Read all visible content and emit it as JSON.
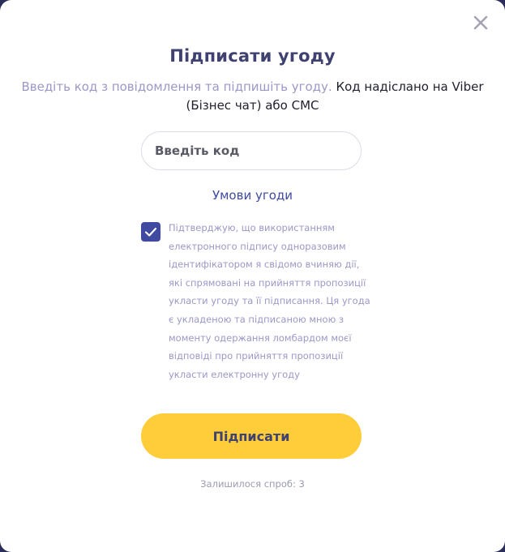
{
  "dialog": {
    "title": "Підписати угоду",
    "subtitle_muted": "Введіть код з повідомлення та підпишіть угоду.",
    "subtitle_dark": " Код надіслано на Viber (Бізнес чат) або СМС",
    "code_input": {
      "placeholder": "Введіть код",
      "value": ""
    },
    "terms_link": "Умови угоди",
    "consent": {
      "checked": true,
      "text": "Підтверджую, що використанням електронного підпису одноразовим ідентифікатором я свідомо вчиняю дії, які спрямовані на прийняття пропозиції укласти угоду та її підписання. Ця угода є укладеною та підписаною мною з моменту одержання ломбардом моєї відповіді про прийняття пропозиції укласти електронну угоду"
    },
    "sign_button": "Підписати",
    "attempts_text": "Залишилося спроб: 3"
  },
  "icons": {
    "close": "close-icon",
    "check": "checkmark-icon"
  },
  "colors": {
    "primary": "#3f4aa0",
    "accent": "#ffcc3a",
    "title": "#3f4170",
    "muted": "#9b98c7"
  }
}
